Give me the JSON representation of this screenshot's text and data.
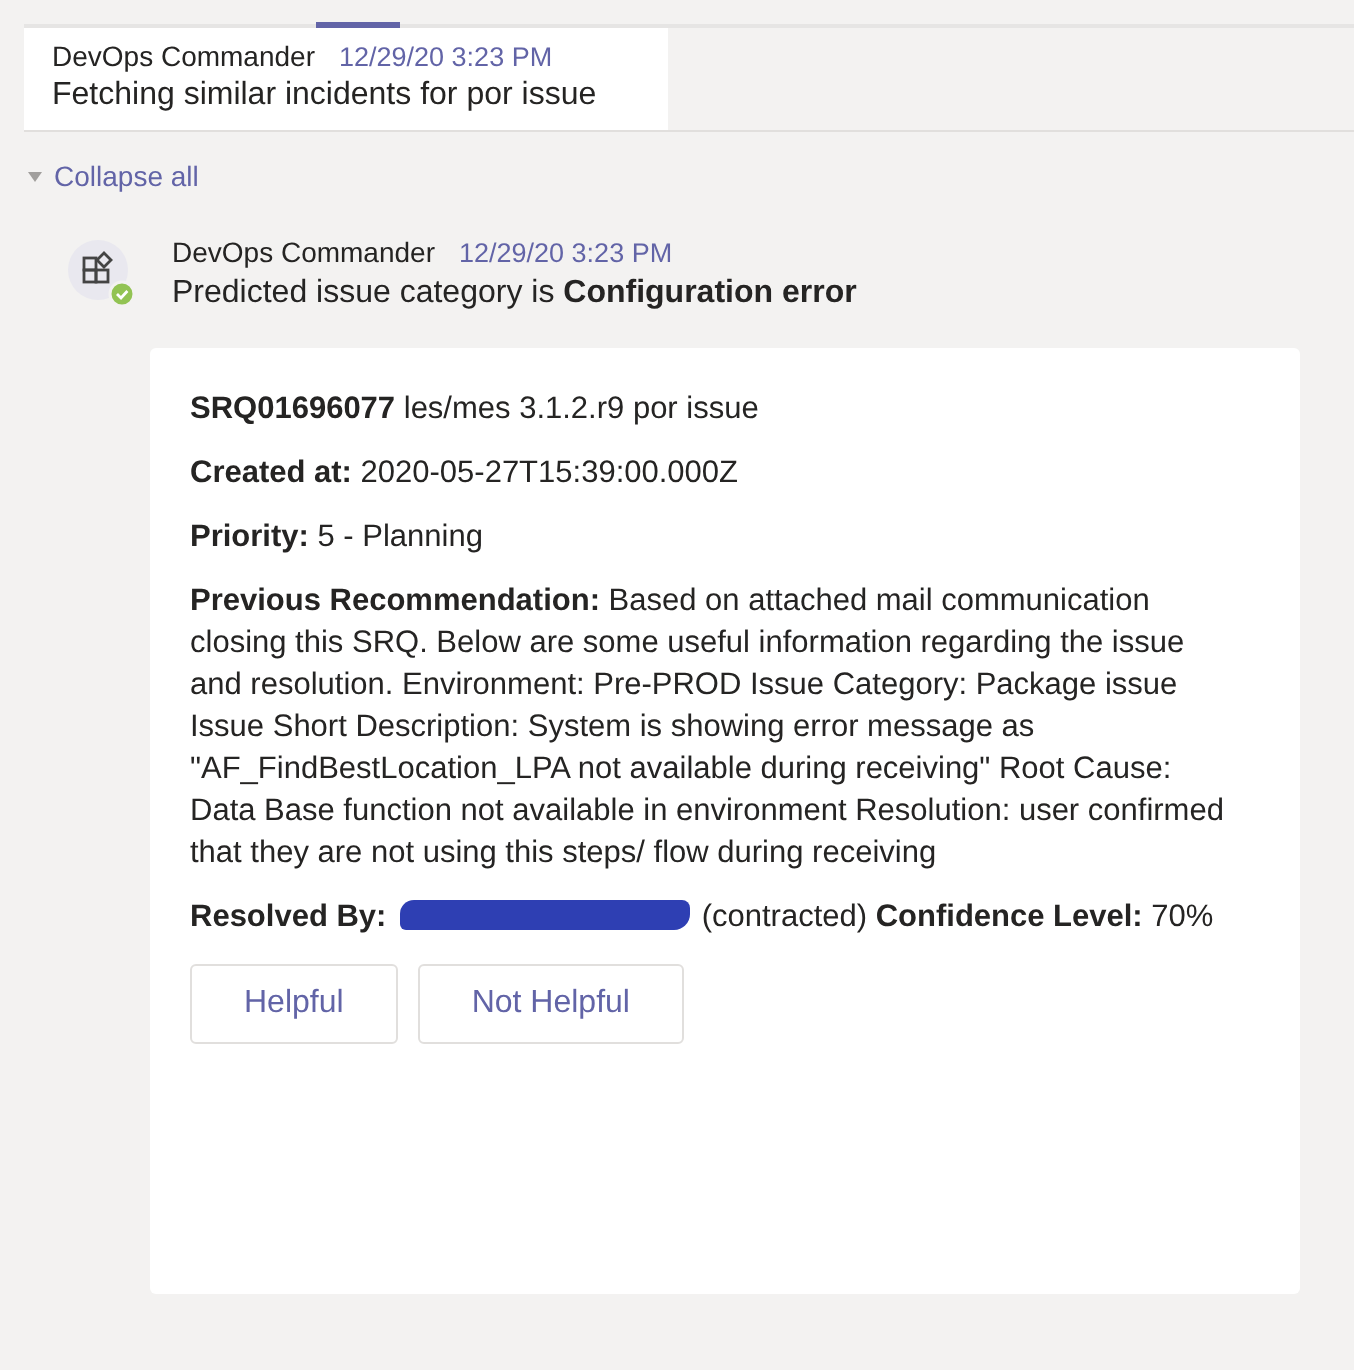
{
  "messages": [
    {
      "author": "DevOps Commander",
      "time": "12/29/20 3:23 PM",
      "text": "Fetching similar incidents for por issue"
    }
  ],
  "thread": {
    "collapse_label": "Collapse all",
    "expanded": true,
    "reply": {
      "author": "DevOps Commander",
      "time": "12/29/20 3:23 PM",
      "text": "Predicted issue category is **Configuration error**",
      "card": {
        "fields": [
          {
            "text": "**SRQ01696077** les/mes 3.1.2.r9 por issue"
          },
          {
            "text": "**Created at:** 2020-05-27T15:39:00.000Z"
          },
          {
            "text": "**Priority:** 5 - Planning"
          },
          {
            "text": "**Previous Recommendation:** Based on attached mail communication closing this SRQ. Below are some useful information regarding the issue and resolution. Environment: Pre-PROD Issue Category: Package issue Issue Short Description: System is showing error message as \"AF_FindBestLocation_LPA not available during receiving\" Root Cause: Data Base function not available in environment Resolution: user confirmed that they are not using this steps/ flow during receiving"
          }
        ],
        "resolved": {
          "label": "Resolved By:",
          "redacted": true,
          "after": "(contracted) **Confidence Level:** 70%"
        },
        "buttons": [
          "Helpful",
          "Not Helpful"
        ]
      }
    }
  }
}
